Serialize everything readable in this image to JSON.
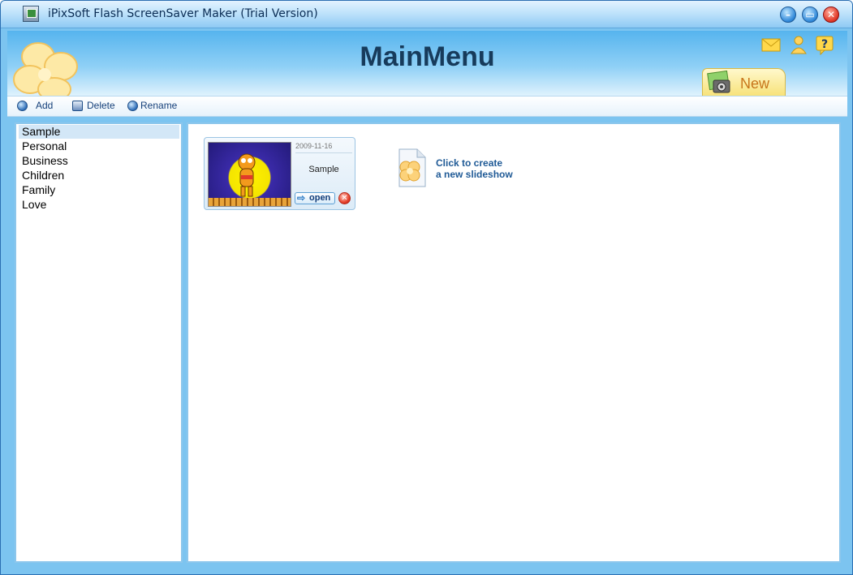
{
  "window": {
    "title": "iPixSoft Flash ScreenSaver Maker (Trial Version)"
  },
  "header": {
    "title": "MainMenu",
    "new_label": "New"
  },
  "toolbar": {
    "add_label": "Add",
    "delete_label": "Delete",
    "rename_label": "Rename"
  },
  "categories": [
    {
      "label": "Sample",
      "selected": true
    },
    {
      "label": "Personal"
    },
    {
      "label": "Business"
    },
    {
      "label": "Children"
    },
    {
      "label": "Family"
    },
    {
      "label": "Love"
    }
  ],
  "slideshows": [
    {
      "date": "2009-11-16",
      "name": "Sample",
      "open_label": "open"
    }
  ],
  "create": {
    "line1": "Click to create",
    "line2": "a new slideshow"
  },
  "colors": {
    "accent": "#1f5a96",
    "header_top": "#56b4ee",
    "selection": "#d3e7f7"
  }
}
